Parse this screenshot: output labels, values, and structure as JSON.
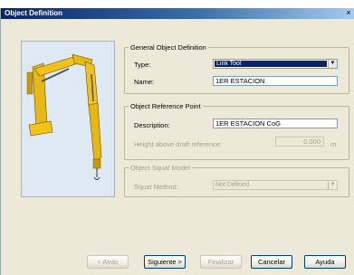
{
  "window": {
    "title": "Object Definition",
    "close_glyph": "×"
  },
  "general": {
    "legend": "General Object Definition",
    "type_label": "Type:",
    "type_value": "Link Tool",
    "name_label": "Name:",
    "name_value": "1ER ESTACION"
  },
  "reference": {
    "legend": "Object Reference Point",
    "description_label": "Description:",
    "description_value": "1ER ESTACION CoG",
    "height_label": "Height above draft reference:",
    "height_value": "0.000",
    "height_unit": "m"
  },
  "squat": {
    "legend": "Object Squat Model",
    "method_label": "Squat Method:",
    "method_value": "Not Defined"
  },
  "buttons": {
    "back": "< Atrás",
    "next": "Siguiente >",
    "finish": "Finalizar",
    "cancel": "Cancelar",
    "help": "Ayuda"
  },
  "colors": {
    "crane_yellow": "#f2c21a",
    "selection": "#0a246a"
  }
}
